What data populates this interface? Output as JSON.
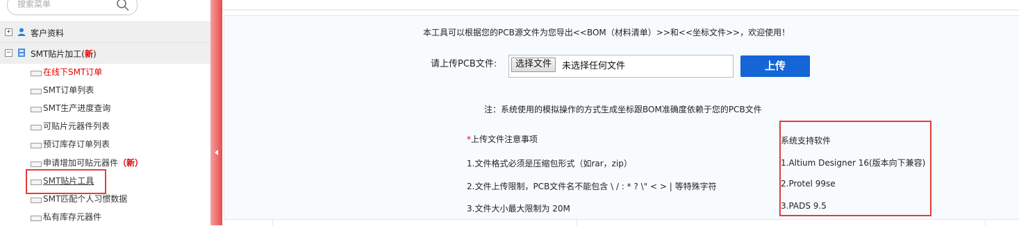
{
  "sidebar": {
    "search_placeholder": "搜索菜单",
    "groups": [
      {
        "label": "客户资料"
      },
      {
        "label": "SMT贴片加工(",
        "new_tag": "新",
        "close_paren": ")"
      }
    ],
    "items": [
      {
        "label": "在线下SMT订单"
      },
      {
        "label": "SMT订单列表"
      },
      {
        "label": "SMT生产进度查询"
      },
      {
        "label": "可贴片元器件列表"
      },
      {
        "label": "预订库存订单列表"
      },
      {
        "label": "申请增加可贴元器件",
        "new_tag": "（新）"
      },
      {
        "label": "SMT贴片工具"
      },
      {
        "label": "SMT匹配个人习惯数据"
      },
      {
        "label": "私有库存元器件"
      }
    ]
  },
  "main": {
    "intro": "本工具可以根据您的PCB源文件为您导出<<BOM（材料清单）>>和<<坐标文件>>，欢迎使用！",
    "upload_label": "请上传PCB文件:",
    "choose_file_label": "选择文件",
    "no_file_text": "未选择任何文件",
    "upload_button": "上传",
    "note": "注：系统使用的模拟操作的方式生成坐标跟BOM准确度依赖于您的PCB文件",
    "notice_star": "*",
    "notice_title": "上传文件注意事项",
    "rules": [
      "1.文件格式必须是压缩包形式（如rar，zip）",
      "2.文件上传限制，PCB文件名不能包含 \\ / : * ? \\\" < > | 等特殊字符",
      "3.文件大小最大限制为 20M"
    ],
    "software_title": "系统支持软件",
    "software": [
      "1.Altium Designer 16(版本向下兼容)",
      "2.Protel 99se",
      "3.PADS 9.5"
    ]
  },
  "colors": {
    "accent_blue": "#1465d6",
    "highlight_red": "#e23b3b",
    "active_red": "#e60000"
  }
}
